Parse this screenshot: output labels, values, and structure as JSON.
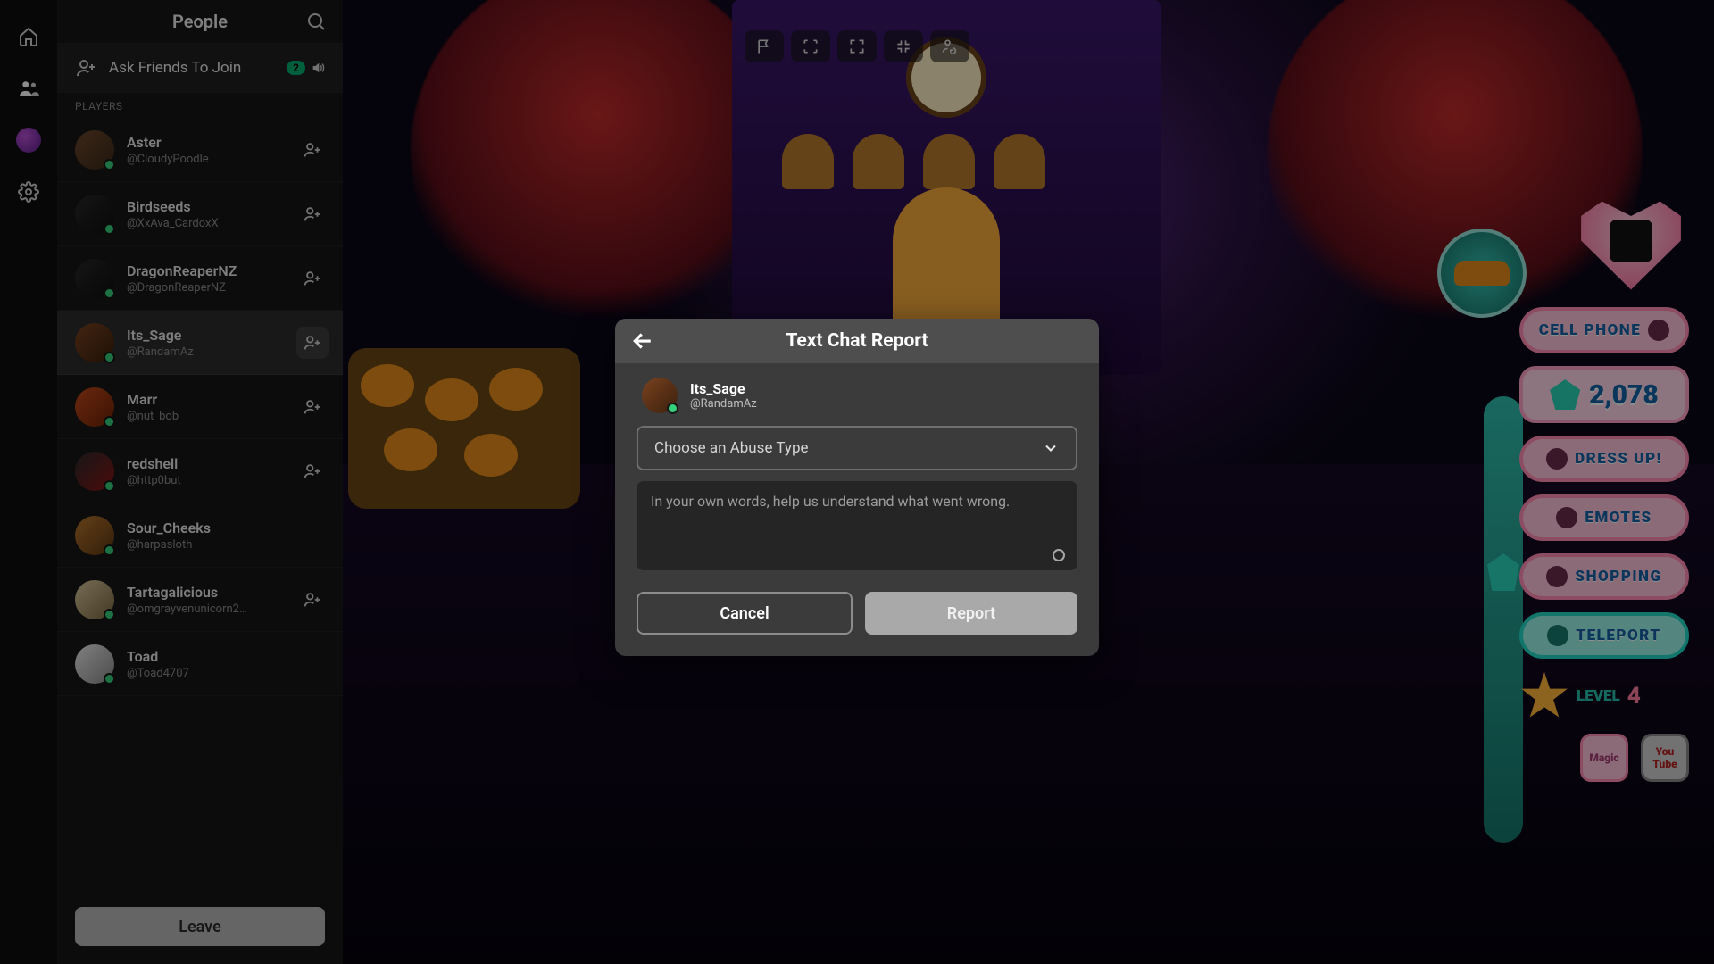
{
  "panel": {
    "title": "People",
    "ask_label": "Ask Friends To Join",
    "ask_count": "2",
    "section_label": "PLAYERS",
    "leave_label": "Leave"
  },
  "players": [
    {
      "name": "Aster",
      "handle": "@CloudyPoodle"
    },
    {
      "name": "Birdseeds",
      "handle": "@XxAva_CardoxX"
    },
    {
      "name": "DragonReaperNZ",
      "handle": "@DragonReaperNZ"
    },
    {
      "name": "Its_Sage",
      "handle": "@RandamAz"
    },
    {
      "name": "Marr",
      "handle": "@nut_bob"
    },
    {
      "name": "redshell",
      "handle": "@http0but"
    },
    {
      "name": "Sour_Cheeks",
      "handle": "@harpasloth"
    },
    {
      "name": "Tartagalicious",
      "handle": "@omgrayvenunicorn2…"
    },
    {
      "name": "Toad",
      "handle": "@Toad4707"
    }
  ],
  "selected_player_index": 3,
  "modal": {
    "title": "Text Chat Report",
    "target_name": "Its_Sage",
    "target_handle": "@RandamAz",
    "abuse_placeholder": "Choose an Abuse Type",
    "desc_placeholder": "In your own words, help us understand what went wrong.",
    "cancel_label": "Cancel",
    "report_label": "Report"
  },
  "hud": {
    "counter_value": "2,078",
    "cell_phone": "CELL PHONE",
    "dress_up": "DRESS UP!",
    "emotes": "EMOTES",
    "shopping": "SHOPPING",
    "teleport": "TELEPORT",
    "level_label": "LEVEL",
    "level_value": "4",
    "magic_label": "Magic",
    "youtube_label_1": "You",
    "youtube_label_2": "Tube"
  }
}
